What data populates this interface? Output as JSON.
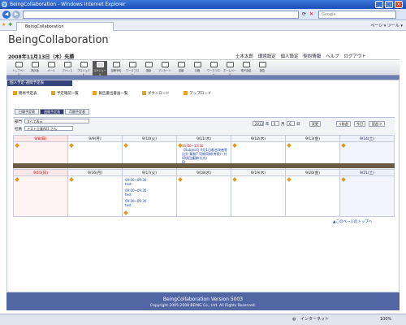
{
  "browser": {
    "title": "BeingCollaboration - Windows Internet Explorer",
    "address": "",
    "search_placeholder": "Google",
    "tab_label": "BeingCollaboration",
    "tools_label": "ページ ▾   ツール ▾",
    "status_zone": "インターネット",
    "zoom": "100%"
  },
  "app": {
    "name": "BeingCollaboration",
    "date": "2008年11月13日（木）先勝",
    "user_menu": [
      "土木太郎",
      "環境設定",
      "個人設定",
      "契約情報",
      "ヘルプ",
      "ログアウト"
    ],
    "toolbar": [
      "トップページ",
      "掲示板",
      "メール",
      "アドレス",
      "プロジェクト",
      "スケジュール",
      "設備予約",
      "ワークフロー",
      "施設",
      "アンケート",
      "書類",
      "日報",
      "ワークフロー",
      "ホームページ",
      "電子会議",
      "回覧"
    ]
  },
  "section": {
    "title": "個人予定-週間予定表",
    "links": [
      "簡易予定表",
      "予定確認一覧",
      "報告書出書画一覧",
      "ダウンロード",
      "アップロード"
    ],
    "view_tabs": [
      "日間予定表",
      "週間予定表",
      "月間予定表"
    ]
  },
  "filters": {
    "dept_label": "部門",
    "dept_value": "すべて表示",
    "user_label": "社員",
    "user_value": "テスト企業A01 さん",
    "year": "2013",
    "month": "9",
    "day": "6",
    "year_unit": "年",
    "month_unit": "月",
    "day_unit": "日",
    "change_btn": "変更",
    "prev_btn": "<前週",
    "today_btn": "今日",
    "next_btn": "翌週 >"
  },
  "week1": {
    "days": [
      "9/8(日)",
      "9/9(月)",
      "9/10(火)",
      "9/11(水)",
      "9/12(木)",
      "9/13(金)",
      "9/14(土)"
    ],
    "event_time": "13:00~13:30",
    "event_text": "【Subject】9月1日都合改善等出先  業務7 同期同期(考察)~共同項目議論(社内)",
    "event_badge": "ID"
  },
  "week2": {
    "days": [
      "9/15(日)",
      "9/16(月)",
      "9/17(火)",
      "9/18(水)",
      "9/19(木)",
      "9/20(金)",
      "9/21(土)"
    ],
    "events": [
      "09:00~09:30",
      "test",
      "09:00~09:30",
      "test",
      "09:00~09:30",
      "test"
    ]
  },
  "more_link": "▲このページのトップへ",
  "footer": {
    "product": "BeingCollaboration   Version 5003",
    "copyright": "Copyright 2005-2008 BEING Co., Ltd. All Rights Reserved."
  }
}
